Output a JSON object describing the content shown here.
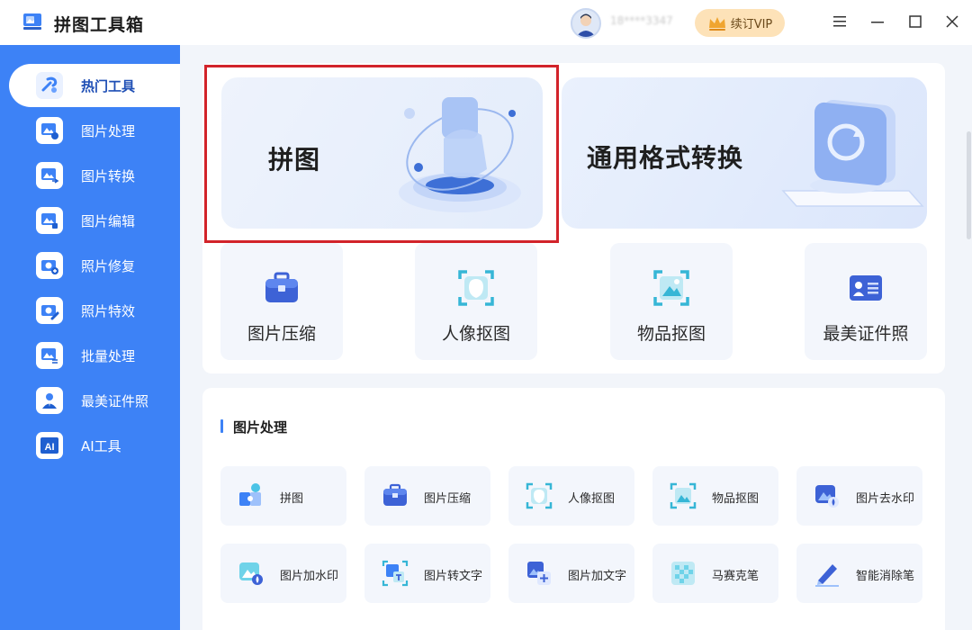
{
  "app": {
    "title": "拼图工具箱",
    "username": "18****3347"
  },
  "header": {
    "vip_label": "续订VIP",
    "logo_icon": "toolbox-logo-icon"
  },
  "window_controls": [
    "menu-icon",
    "minimize-icon",
    "maximize-icon",
    "close-icon"
  ],
  "sidebar": {
    "items": [
      {
        "label": "热门工具",
        "icon": "hot-tools-icon",
        "active": true
      },
      {
        "label": "图片处理",
        "icon": "image-process-icon"
      },
      {
        "label": "图片转换",
        "icon": "image-convert-icon"
      },
      {
        "label": "图片编辑",
        "icon": "image-edit-icon"
      },
      {
        "label": "照片修复",
        "icon": "photo-repair-icon"
      },
      {
        "label": "照片特效",
        "icon": "photo-effects-icon"
      },
      {
        "label": "批量处理",
        "icon": "batch-process-icon"
      },
      {
        "label": "最美证件照",
        "icon": "id-photo-icon"
      },
      {
        "label": "AI工具",
        "icon": "ai-tools-icon"
      }
    ]
  },
  "banners": [
    {
      "title": "拼图",
      "icon": "puzzle-illustration-icon",
      "highlighted": true
    },
    {
      "title": "通用格式转换",
      "icon": "format-convert-illustration-icon"
    }
  ],
  "hot_tools": [
    {
      "label": "图片压缩",
      "icon": "compress-toolbox-icon"
    },
    {
      "label": "人像抠图",
      "icon": "portrait-cutout-icon"
    },
    {
      "label": "物品抠图",
      "icon": "object-cutout-icon"
    },
    {
      "label": "最美证件照",
      "icon": "id-card-icon"
    }
  ],
  "section": {
    "title": "图片处理",
    "tools": [
      {
        "label": "拼图",
        "icon": "puzzle-icon"
      },
      {
        "label": "图片压缩",
        "icon": "compress-icon"
      },
      {
        "label": "人像抠图",
        "icon": "portrait-cutout-icon"
      },
      {
        "label": "物品抠图",
        "icon": "object-cutout-icon"
      },
      {
        "label": "图片去水印",
        "icon": "remove-watermark-icon"
      },
      {
        "label": "图片加水印",
        "icon": "add-watermark-icon"
      },
      {
        "label": "图片转文字",
        "icon": "image-to-text-icon"
      },
      {
        "label": "图片加文字",
        "icon": "add-text-icon"
      },
      {
        "label": "马赛克笔",
        "icon": "mosaic-pen-icon"
      },
      {
        "label": "智能消除笔",
        "icon": "smart-eraser-icon"
      }
    ]
  },
  "colors": {
    "primary": "#3d82f6",
    "highlight": "#d2232a",
    "vip_bg": "#fde2b8"
  }
}
